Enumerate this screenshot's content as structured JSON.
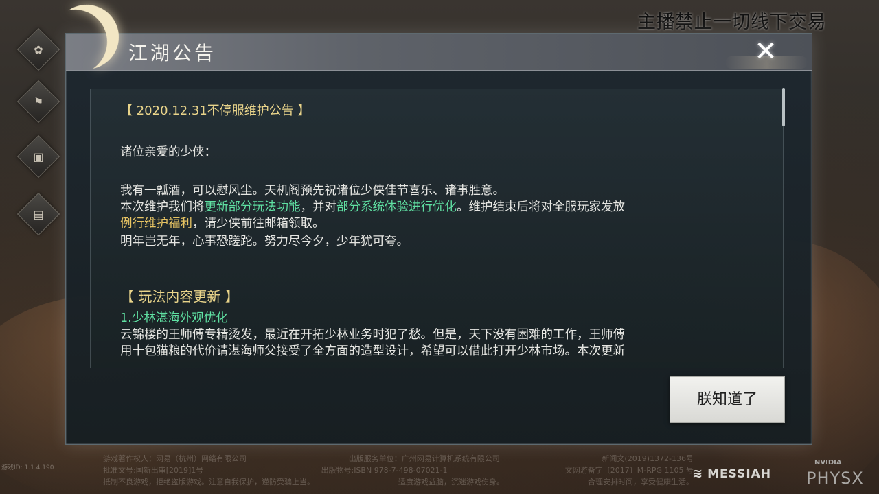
{
  "streamer_notice": "主播禁止一切线下交易",
  "side_nav": {
    "items": [
      {
        "icon": "gear-icon",
        "glyph": "✿"
      },
      {
        "icon": "flag-icon",
        "glyph": "⚑"
      },
      {
        "icon": "film-icon",
        "glyph": "▣"
      },
      {
        "icon": "scroll-icon",
        "glyph": "▤"
      }
    ]
  },
  "dialog": {
    "title": "江湖公告",
    "close_icon": "close-icon",
    "close_glyph": "✕",
    "confirm_label": "朕知道了",
    "announcement": {
      "heading": "【 2020.12.31不停服维护公告 】",
      "greeting": "诸位亲爱的少侠：",
      "p1": "我有一瓢酒，可以慰风尘。天机阁预先祝诸位少侠佳节喜乐、诸事胜意。",
      "p2_a": "本次维护我们将",
      "p2_b": "更新部分玩法功能",
      "p2_c": "，并对",
      "p2_d": "部分系统体验进行优化",
      "p2_e": "。维护结束后将对全服玩家发放",
      "p3_a": "例行维护福利",
      "p3_b": "，请少侠前往邮箱领取。",
      "p4": "明年岂无年，心事恐蹉跎。努力尽今夕，少年犹可夸。",
      "section_title": "【 玩法内容更新 】",
      "item1_title": "1.少林湛海外观优化",
      "item1_l1": "云锦楼的王师傅专精烫发，最近在开拓少林业务时犯了愁。但是，天下没有困难的工作，王师傅",
      "item1_l2": "用十包猫粮的代价请湛海师父接受了全方面的造型设计，希望可以借此打开少林市场。本次更新"
    }
  },
  "footer": {
    "row1": [
      "游戏著作权人：网易（杭州）网络有限公司",
      "出版服务单位：广州网易计算机系统有限公司",
      "新闻文(2019)1372-136号"
    ],
    "row2": [
      "批准文号:国新出审[2019]1号",
      "出版物号:ISBN 978-7-498-07021-1",
      "文网游备字〔2017〕M-RPG 1105 号"
    ],
    "row3": [
      "抵制不良游戏，拒绝盗版游戏。注意自我保护，谨防受骗上当。",
      "适度游戏益脑，沉迷游戏伤身。",
      "合理安排时间，享受健康生活。"
    ],
    "small": "游戏ID: 1.1.4.190"
  },
  "brands": {
    "messiah": "MESSIAH",
    "nvidia": "NVIDIA",
    "physx": "PHYSX"
  }
}
